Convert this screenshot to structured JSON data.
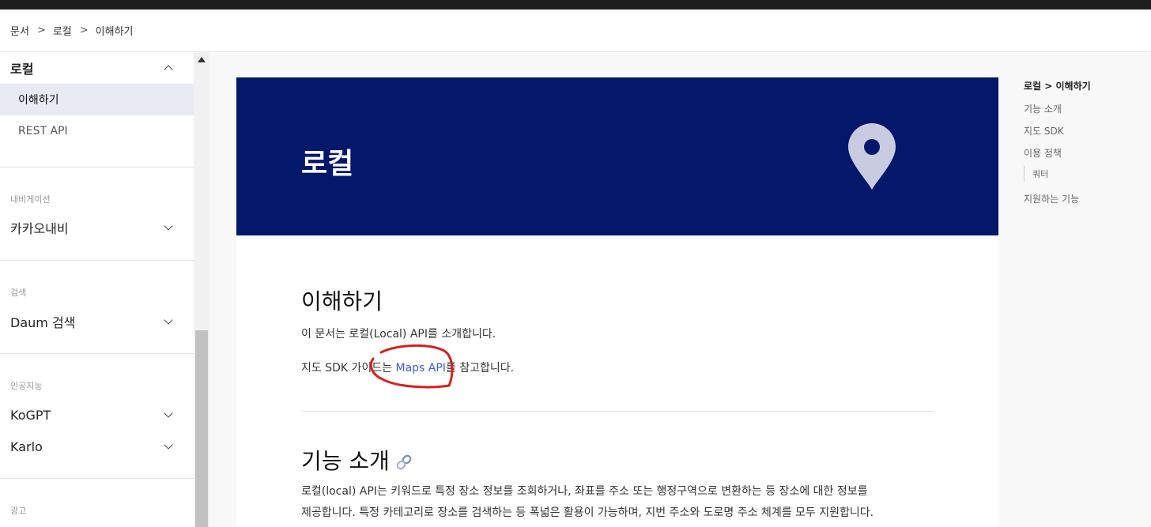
{
  "breadcrumb": {
    "items": [
      "문서",
      "로컬",
      "이해하기"
    ],
    "separator": ">"
  },
  "sidebar": {
    "local": {
      "label": "로컬",
      "items": [
        {
          "label": "이해하기",
          "active": true
        },
        {
          "label": "REST API",
          "active": false
        }
      ]
    },
    "navigation": {
      "category": "내비게이션",
      "label": "카카오내비"
    },
    "search": {
      "category": "검색",
      "label": "Daum 검색"
    },
    "ai": {
      "category": "인공지능",
      "items": [
        "KoGPT",
        "Karlo"
      ]
    },
    "ads": {
      "category": "광고"
    }
  },
  "hero": {
    "title": "로컬",
    "icon": "map-pin-icon",
    "background": "#03176b"
  },
  "content": {
    "section1_title": "이해하기",
    "p1": "이 문서는 로컬(Local) API를 소개합니다.",
    "p2_before": "지도 SDK 가이드는 ",
    "p2_link": "Maps API",
    "p2_after": "를 참고합니다.",
    "section2_title": "기능 소개",
    "p3_line1": "로컬(local) API는 키워드로 특정 장소 정보를 조회하거나, 좌표를 주소 또는 행정구역으로 변환하는 등 장소에 대한 정보를",
    "p3_line2": "제공합니다. 특정 카테고리로 장소를 검색하는 등 폭넓은 활용이 가능하며, 지번 주소와 도로명 주소 체계를 모두 지원합니다."
  },
  "toc": {
    "items": [
      "로컬 > 이해하기",
      "기능 소개",
      "지도 SDK",
      "이용 정책"
    ],
    "sub": "쿼터",
    "last": "지원하는 기능"
  },
  "colors": {
    "link": "#3b5bd9",
    "annotation": "#d62020",
    "active_bg": "#e9ebf3"
  }
}
